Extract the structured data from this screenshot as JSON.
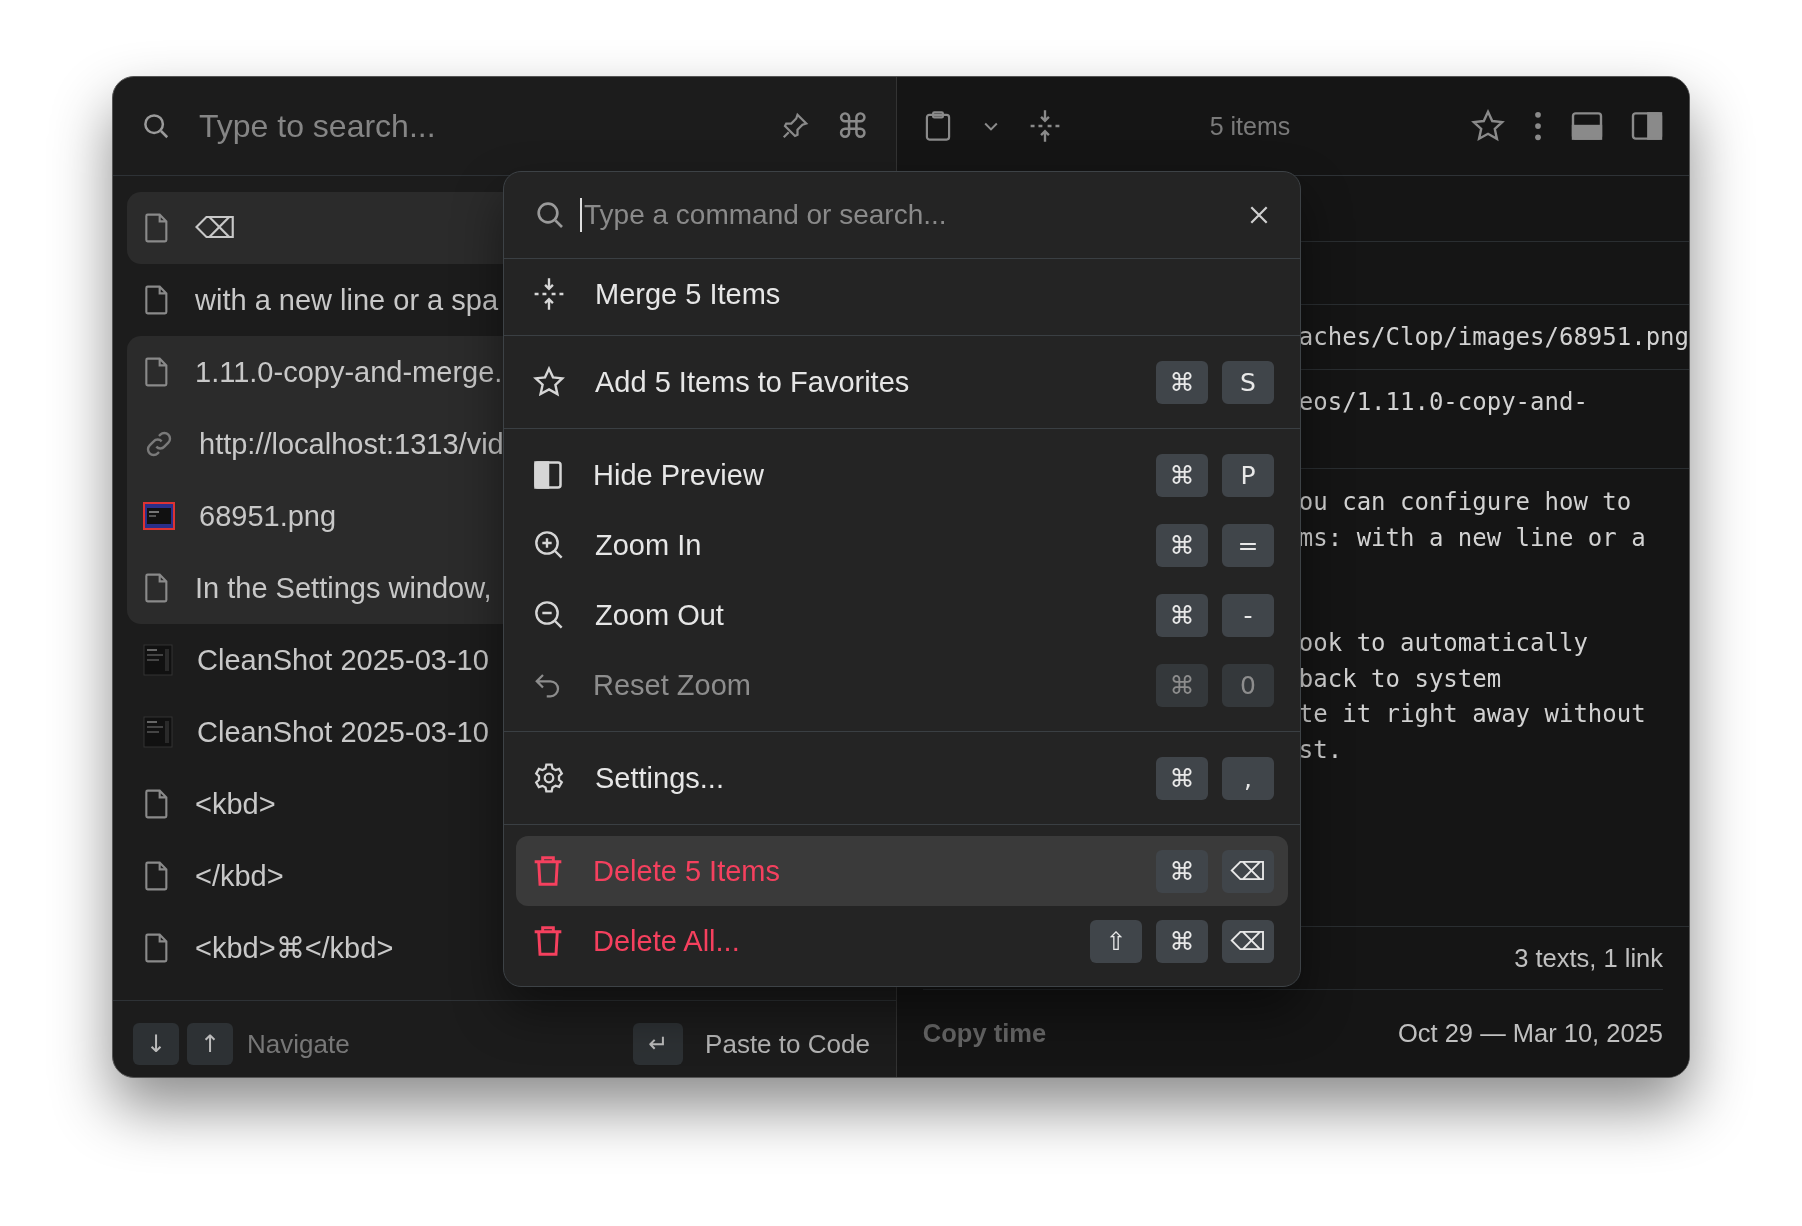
{
  "search": {
    "placeholder": "Type to search...",
    "shortcut_glyph": "⌘"
  },
  "items": [
    {
      "kind": "text",
      "text": "⌫",
      "selected": true
    },
    {
      "kind": "text",
      "text": "with a new line or a spa",
      "selected": false
    },
    {
      "kind": "text",
      "text": "1.11.0-copy-and-merge.",
      "selected": true
    },
    {
      "kind": "link",
      "text": "http://localhost:1313/vid",
      "selected": true
    },
    {
      "kind": "image",
      "text": "68951.png",
      "selected": true
    },
    {
      "kind": "text",
      "text": "In the Settings window,",
      "selected": true
    },
    {
      "kind": "screenshot",
      "text": "CleanShot 2025-03-10",
      "selected": false
    },
    {
      "kind": "screenshot",
      "text": "CleanShot 2025-03-10",
      "selected": false
    },
    {
      "kind": "text",
      "text": "<kbd>",
      "selected": false
    },
    {
      "kind": "text",
      "text": "</kbd>",
      "selected": false
    },
    {
      "kind": "text",
      "text": "<kbd>⌘</kbd>",
      "selected": false
    }
  ],
  "footer": {
    "nav_keys": [
      "↓",
      "↑"
    ],
    "navigate": "Navigate",
    "paste_key": "↵",
    "paste_label": "Paste to Code"
  },
  "toolbar": {
    "count": "5 items"
  },
  "preview": {
    "path": "aches/Clop/images/68951.png",
    "url": "eos/1.11.0-copy-and-",
    "paragraphs": [
      [
        "ou can configure how to",
        "ms: with a new line or a"
      ],
      [
        "ook to automatically",
        "back to system",
        "te it right away without",
        "st."
      ]
    ]
  },
  "info": {
    "summary": "3 texts, 1 link",
    "copy_time_label": "Copy time",
    "copy_time": "Oct 29 — Mar 10, 2025"
  },
  "palette": {
    "placeholder": "Type a command or search...",
    "groups": [
      {
        "commands": [
          {
            "kind": "merge",
            "label": "Merge 5 Items",
            "disabled": false,
            "selected": false
          }
        ]
      },
      {
        "commands": [
          {
            "kind": "favorite",
            "label": "Add 5 Items to Favorites",
            "keys": [
              "⌘",
              "S"
            ],
            "disabled": false,
            "selected": false
          }
        ]
      },
      {
        "commands": [
          {
            "kind": "preview",
            "label": "Hide Preview",
            "keys": [
              "⌘",
              "P"
            ],
            "disabled": false,
            "selected": false
          },
          {
            "kind": "zoom-in",
            "label": "Zoom In",
            "keys": [
              "⌘",
              "="
            ],
            "disabled": false,
            "selected": false
          },
          {
            "kind": "zoom-out",
            "label": "Zoom Out",
            "keys": [
              "⌘",
              "-"
            ],
            "disabled": false,
            "selected": false
          },
          {
            "kind": "reset",
            "label": "Reset Zoom",
            "keys": [
              "⌘",
              "0"
            ],
            "disabled": true,
            "selected": false
          }
        ]
      },
      {
        "commands": [
          {
            "kind": "settings",
            "label": "Settings...",
            "keys": [
              "⌘",
              ","
            ],
            "disabled": false,
            "selected": false
          }
        ]
      },
      {
        "commands": [
          {
            "kind": "delete",
            "label": "Delete 5 Items",
            "keys": [
              "⌘",
              "⌫"
            ],
            "disabled": false,
            "selected": true
          },
          {
            "kind": "delete",
            "label": "Delete All...",
            "keys": [
              "⇧",
              "⌘",
              "⌫"
            ],
            "disabled": false,
            "selected": false
          }
        ]
      }
    ]
  }
}
